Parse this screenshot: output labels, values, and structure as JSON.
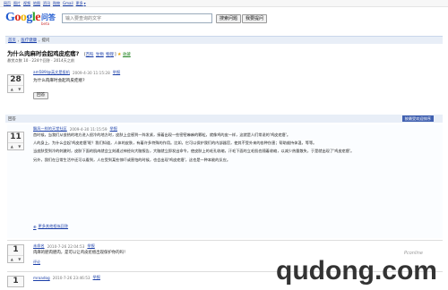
{
  "topbar": {
    "links": [
      "网页",
      "图片",
      "视频",
      "地图",
      "资讯",
      "购物",
      "Gmail"
    ],
    "more": "更多"
  },
  "header": {
    "logo_text": "Google",
    "logo_sub": "问答",
    "logo_beta": "beta",
    "search_placeholder": "输入要查询的文字",
    "search_button": "搜索问题",
    "ask_button": "我要提问"
  },
  "breadcrumb": {
    "home": "首页",
    "sep": "›",
    "category": "医疗健康",
    "current": "提问"
  },
  "question": {
    "title": "为什么肉麻时会起鸡皮疙瘩?",
    "tags": [
      "百科",
      "生物",
      "物理"
    ],
    "save": "收藏",
    "meta": "悬赏点数 10 · 224个回答 · 2014天之前",
    "votes": "28",
    "vote_up": "▲",
    "vote_down": "▼",
    "author": "am589l@英文是投机",
    "time": "2009-4-30 11:15:28",
    "report": "举报",
    "body": "为什么肉麻时会起鸡皮疙瘩?",
    "answer_button": "回答"
  },
  "answers_bar": {
    "label": "回答",
    "right_link": "按最受欢迎排序"
  },
  "answer1": {
    "votes": "11",
    "vote_up": "▲",
    "vote_down": "▼",
    "author": "飘风—样的天堂社区",
    "time": "2009-4-30 11:15:59",
    "report": "举报",
    "paragraphs": [
      "首时候，当我们从很热的地方进入很冷的地方时，皮肤上会感到一阵发紧，接着出现一些密密麻麻的颗粒，就像鸡的皮一样，这就是人们常说的'鸡皮疙瘩'。",
      "人的身上，为什么会起'鸡皮疙瘩'呢？我们知道，人体的皮肤，有着许多特殊的作用。比如，它可以保护我们的内部器官，使其不受外来的各种伤害；帮助维持体温，等等。",
      "当皮肤受到冷的刺激时，皮肤下面的肌肉就会立刻通过神经向大脑报告，大脑就立即发出命令，使皮肤上的毛孔收缩，汗毛下面的立毛肌也随着收缩，以减少热量散失，于是就出现了'鸡皮疙瘩'。",
      "另外，我们在日常生活中还可以看到，人在受到某些惊吓或害怕的时候，也会出现'鸡皮疙瘩'，这也是一种本能的反应。"
    ],
    "more_link": "更多其他相似回答"
  },
  "answer2": {
    "votes": "1",
    "vote_up": "▲",
    "vote_down": "▼",
    "author": "未命名",
    "time": "2010-7-26 22:04:53",
    "report": "举报",
    "text": "肉麻的肥肉肥肉，是可以让鸡皮疙瘩出现保护你的吗！",
    "link": "评论"
  },
  "answer3": {
    "votes": "1",
    "vote_up": "▲",
    "vote_down": "▼",
    "author": "mroadog",
    "time": "2010-7-26 23:46:53",
    "report": "举报"
  },
  "watermark": {
    "small": "Pconline",
    "big": "qudong.com"
  }
}
